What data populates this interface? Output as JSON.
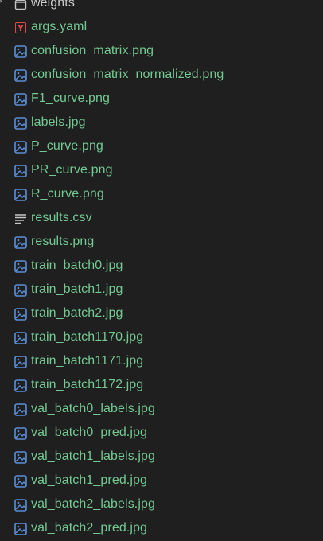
{
  "explorer": {
    "folder": {
      "label": "weights",
      "icon": "folder-icon"
    },
    "files": [
      {
        "label": "args.yaml",
        "icon": "yaml-file-icon"
      },
      {
        "label": "confusion_matrix.png",
        "icon": "image-file-icon"
      },
      {
        "label": "confusion_matrix_normalized.png",
        "icon": "image-file-icon"
      },
      {
        "label": "F1_curve.png",
        "icon": "image-file-icon"
      },
      {
        "label": "labels.jpg",
        "icon": "image-file-icon"
      },
      {
        "label": "P_curve.png",
        "icon": "image-file-icon"
      },
      {
        "label": "PR_curve.png",
        "icon": "image-file-icon"
      },
      {
        "label": "R_curve.png",
        "icon": "image-file-icon"
      },
      {
        "label": "results.csv",
        "icon": "csv-file-icon"
      },
      {
        "label": "results.png",
        "icon": "image-file-icon"
      },
      {
        "label": "train_batch0.jpg",
        "icon": "image-file-icon"
      },
      {
        "label": "train_batch1.jpg",
        "icon": "image-file-icon"
      },
      {
        "label": "train_batch2.jpg",
        "icon": "image-file-icon"
      },
      {
        "label": "train_batch1170.jpg",
        "icon": "image-file-icon"
      },
      {
        "label": "train_batch1171.jpg",
        "icon": "image-file-icon"
      },
      {
        "label": "train_batch1172.jpg",
        "icon": "image-file-icon"
      },
      {
        "label": "val_batch0_labels.jpg",
        "icon": "image-file-icon"
      },
      {
        "label": "val_batch0_pred.jpg",
        "icon": "image-file-icon"
      },
      {
        "label": "val_batch1_labels.jpg",
        "icon": "image-file-icon"
      },
      {
        "label": "val_batch1_pred.jpg",
        "icon": "image-file-icon"
      },
      {
        "label": "val_batch2_labels.jpg",
        "icon": "image-file-icon"
      },
      {
        "label": "val_batch2_pred.jpg",
        "icon": "image-file-icon"
      }
    ],
    "colors": {
      "background": "#1f1f1f",
      "file_text": "#73c991",
      "folder_text": "#cccccc",
      "image_icon": "#5a8fd8",
      "yaml_icon": "#e0474a",
      "csv_icon": "#c5c5c5"
    }
  }
}
